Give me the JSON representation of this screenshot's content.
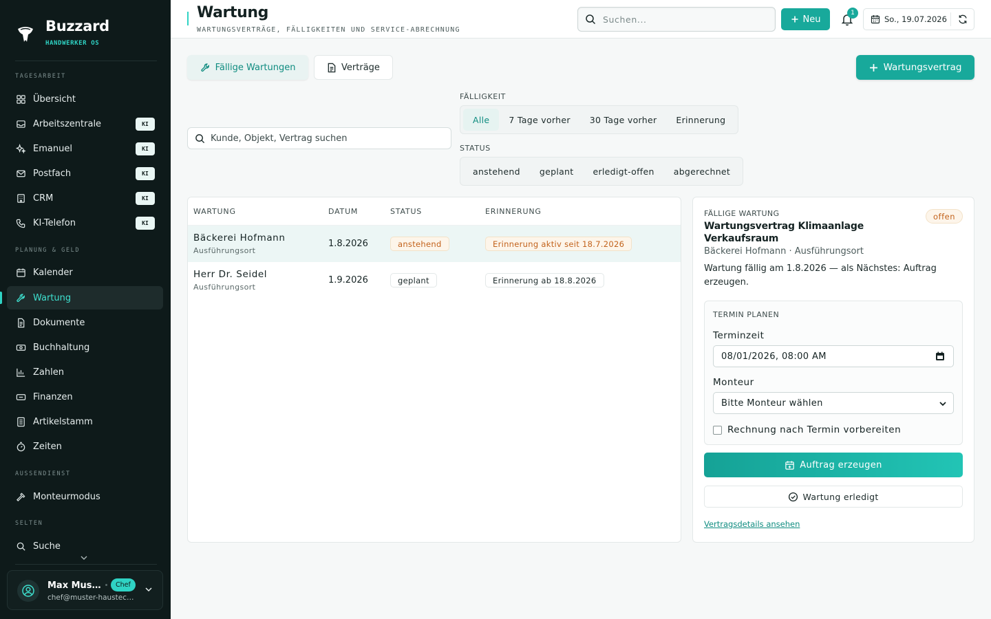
{
  "colors": {
    "accent": "#18a99b",
    "sidebar_bg": "#0e1a1a",
    "warning": "#c2621b"
  },
  "brand": {
    "name": "Buzzard",
    "subtitle": "HANDWERKER OS"
  },
  "sidebar": {
    "sections": [
      {
        "label": "TAGESARBEIT",
        "items": [
          {
            "label": "Übersicht",
            "icon": "grid-icon",
            "badge": ""
          },
          {
            "label": "Arbeitszentrale",
            "icon": "inbox-icon",
            "badge": "KI"
          },
          {
            "label": "Emanuel",
            "icon": "sparkles-icon",
            "badge": "KI"
          },
          {
            "label": "Postfach",
            "icon": "mail-icon",
            "badge": "KI"
          },
          {
            "label": "CRM",
            "icon": "building-icon",
            "badge": "KI"
          },
          {
            "label": "KI-Telefon",
            "icon": "phone-icon",
            "badge": "KI"
          }
        ]
      },
      {
        "label": "PLANUNG & GELD",
        "items": [
          {
            "label": "Kalender",
            "icon": "calendar-icon",
            "badge": ""
          },
          {
            "label": "Wartung",
            "icon": "wrench-icon",
            "badge": "",
            "active": true
          },
          {
            "label": "Dokumente",
            "icon": "document-icon",
            "badge": ""
          },
          {
            "label": "Buchhaltung",
            "icon": "banknote-icon",
            "badge": ""
          },
          {
            "label": "Zahlen",
            "icon": "bar-chart-icon",
            "badge": ""
          },
          {
            "label": "Finanzen",
            "icon": "wallet-icon",
            "badge": ""
          },
          {
            "label": "Artikelstamm",
            "icon": "list-icon",
            "badge": ""
          },
          {
            "label": "Zeiten",
            "icon": "timer-icon",
            "badge": ""
          }
        ]
      },
      {
        "label": "AUSSENDIENST",
        "items": [
          {
            "label": "Monteurmodus",
            "icon": "hammer-icon",
            "badge": ""
          }
        ]
      },
      {
        "label": "SELTEN",
        "items": [
          {
            "label": "Suche",
            "icon": "search-icon",
            "badge": ""
          }
        ]
      }
    ],
    "user": {
      "name": "Max Mustermann",
      "role": "Chef",
      "email": "chef@muster-haustechnik.de"
    }
  },
  "header": {
    "title": "Wartung",
    "subtitle": "WARTUNGSVERTRÄGE, FÄLLIGKEITEN UND SERVICE-ABRECHNUNG",
    "search_placeholder": "Suchen...",
    "new_label": "Neu",
    "notification_count": "1",
    "date": "So., 19.07.2026"
  },
  "tabs": {
    "faellig": "Fällige Wartungen",
    "vertraege": "Verträge",
    "new_contract": "Wartungsvertrag"
  },
  "filters": {
    "search_placeholder": "Kunde, Objekt, Vertrag suchen",
    "faelligkeit_label": "FÄLLIGKEIT",
    "faelligkeit_options": [
      "Alle",
      "7 Tage vorher",
      "30 Tage vorher",
      "Erinnerung"
    ],
    "faelligkeit_selected": "Alle",
    "status_label": "STATUS",
    "status_options": [
      "anstehend",
      "geplant",
      "erledigt-offen",
      "abgerechnet"
    ]
  },
  "table": {
    "columns": [
      "WARTUNG",
      "DATUM",
      "STATUS",
      "ERINNERUNG"
    ],
    "rows": [
      {
        "name": "Bäckerei Hofmann",
        "sub": "Ausführungsort",
        "date": "1.8.2026",
        "status": "anstehend",
        "reminder": "Erinnerung aktiv seit 18.7.2026",
        "selected": true
      },
      {
        "name": "Herr Dr. Seidel",
        "sub": "Ausführungsort",
        "date": "1.9.2026",
        "status": "geplant",
        "reminder": "Erinnerung ab 18.8.2026",
        "selected": false
      }
    ]
  },
  "detail": {
    "eyebrow": "FÄLLIGE WARTUNG",
    "badge": "offen",
    "title": "Wartungsvertrag Klimaanlage Verkaufsraum",
    "subtitle": "Bäckerei Hofmann · Ausführungsort",
    "text": "Wartung fällig am 1.8.2026 — als Nächstes: Auftrag erzeugen.",
    "plan_label": "TERMIN PLANEN",
    "terminzeit_label": "Terminzeit",
    "terminzeit_value": "08/01/2026, 08:00 AM",
    "monteur_label": "Monteur",
    "monteur_value": "Bitte Monteur wählen",
    "checkbox_label": "Rechnung nach Termin vorbereiten",
    "checkbox_checked": false,
    "btn_auftrag": "Auftrag erzeugen",
    "btn_erledigt": "Wartung erledigt",
    "link": "Vertragsdetails ansehen"
  }
}
